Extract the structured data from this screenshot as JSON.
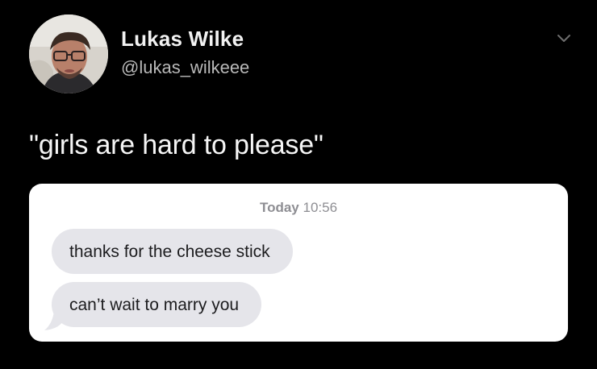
{
  "profile": {
    "display_name": "Lukas Wilke",
    "handle": "@lukas_wilkeee",
    "avatar_icon": "profile-photo",
    "more_icon": "chevron-down-icon"
  },
  "tweet": {
    "text": "\"girls are hard to please\""
  },
  "screenshot": {
    "timestamp_day": "Today",
    "timestamp_time": "10:56",
    "messages": [
      "thanks for the cheese stick",
      "can’t wait to marry you"
    ],
    "bubble_color": "#e5e5ea"
  },
  "colors": {
    "background": "#000000",
    "handle": "#b9b9b9",
    "card": "#ffffff"
  }
}
